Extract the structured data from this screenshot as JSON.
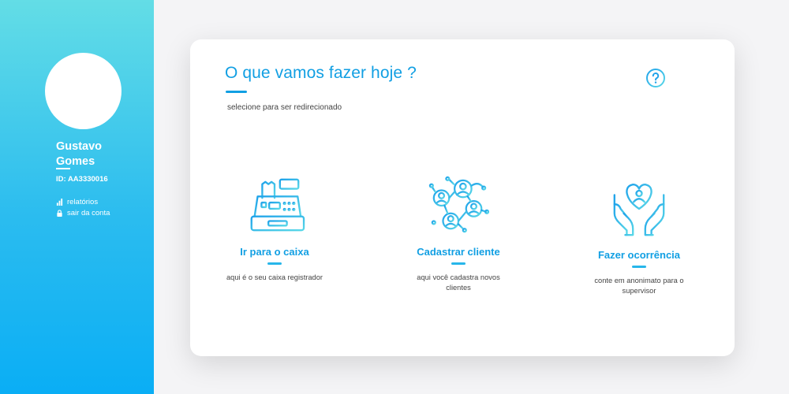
{
  "sidebar": {
    "user_name": "Gustavo Gomes",
    "user_id": "ID: AA3330016",
    "links": [
      {
        "label": "relatórios",
        "icon": "bar-chart-icon"
      },
      {
        "label": "sair da conta",
        "icon": "lock-icon"
      }
    ],
    "gradient": [
      "#63dde6",
      "#0aaef5"
    ]
  },
  "main": {
    "title": "O que vamos fazer hoje ?",
    "subtitle": "selecione para ser redirecionado",
    "help_icon": "question-circle-icon",
    "options": [
      {
        "label": "Ir para o caixa",
        "description": "aqui é o seu caixa registrador",
        "icon": "cash-register-icon"
      },
      {
        "label": "Cadastrar cliente",
        "description": "aqui você cadastra novos clientes",
        "icon": "customer-network-icon"
      },
      {
        "label": "Fazer ocorrência",
        "description": "conte em anonimato para o supervisor",
        "icon": "hands-heart-icon"
      }
    ]
  },
  "colors": {
    "accent": "#119fe3",
    "gradient_start": "#63dde6",
    "gradient_end": "#0aaef5"
  }
}
